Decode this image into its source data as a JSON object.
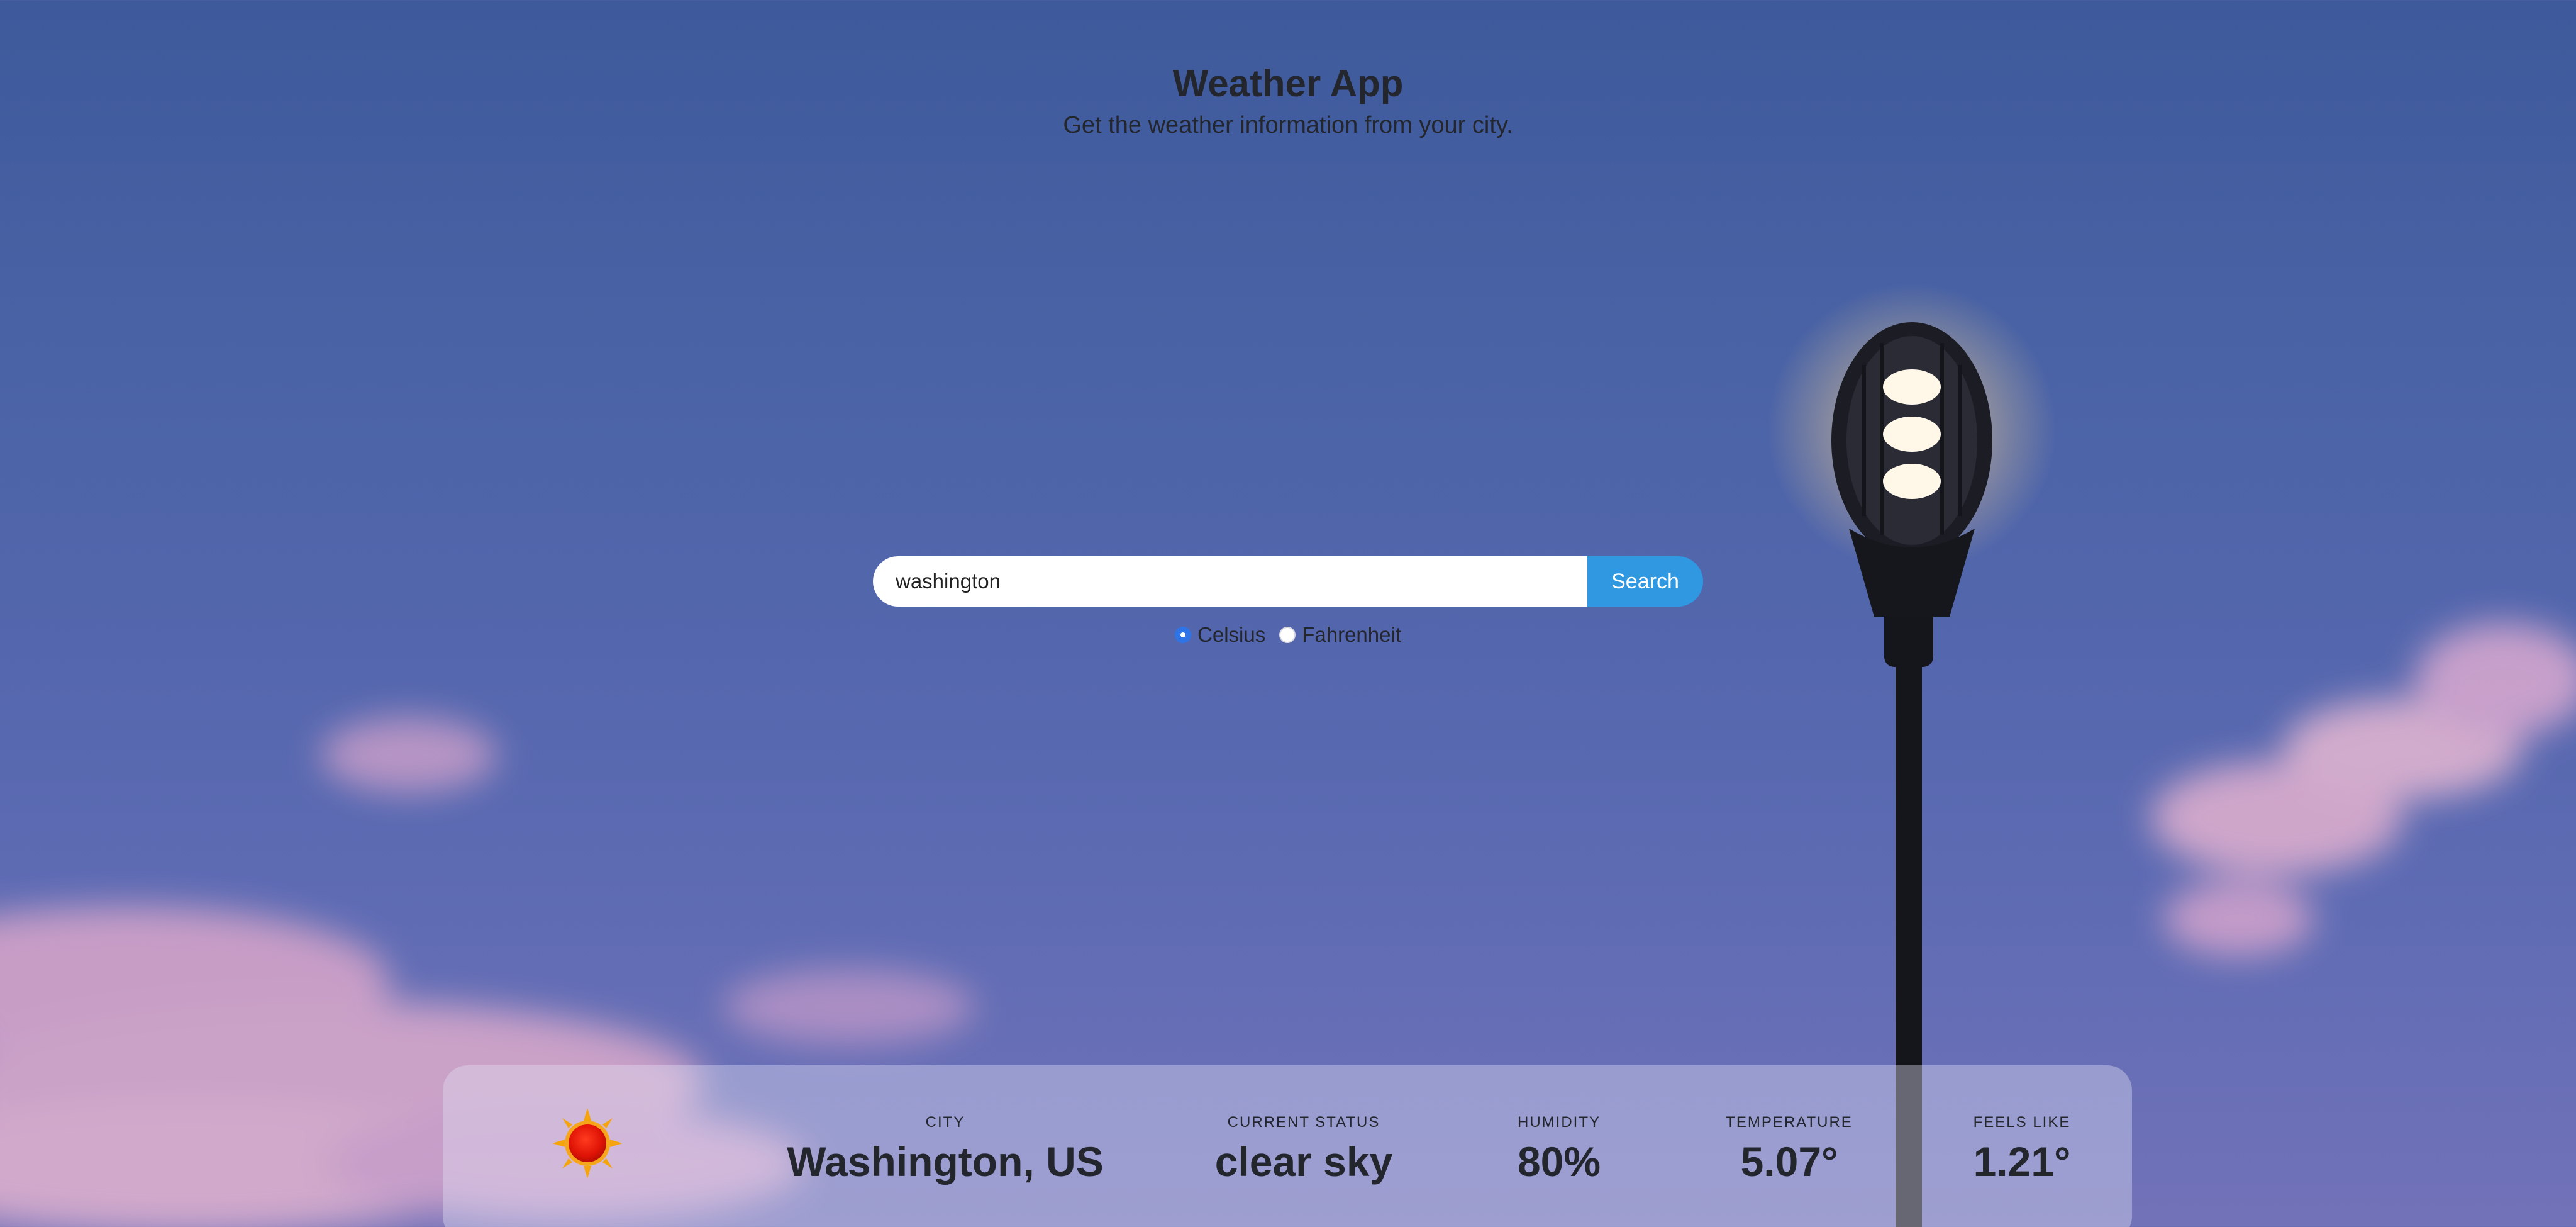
{
  "app": {
    "title": "Weather App",
    "subtitle": "Get the weather information from your city."
  },
  "search": {
    "value": "washington",
    "button_label": "Search"
  },
  "units": {
    "options": [
      {
        "label": "Celsius",
        "checked": true
      },
      {
        "label": "Fahrenheit",
        "checked": false
      }
    ]
  },
  "weather": {
    "icon": "sun-icon",
    "stats": [
      {
        "label": "CITY",
        "value": "Washington, US"
      },
      {
        "label": "CURRENT STATUS",
        "value": "clear sky"
      },
      {
        "label": "HUMIDITY",
        "value": "80%"
      },
      {
        "label": "TEMPERATURE",
        "value": "5.07°"
      },
      {
        "label": "FEELS LIKE",
        "value": "1.21°"
      }
    ]
  },
  "colors": {
    "accent": "#2f98e0",
    "radio_checked": "#2f74e6",
    "text": "#24262e"
  }
}
